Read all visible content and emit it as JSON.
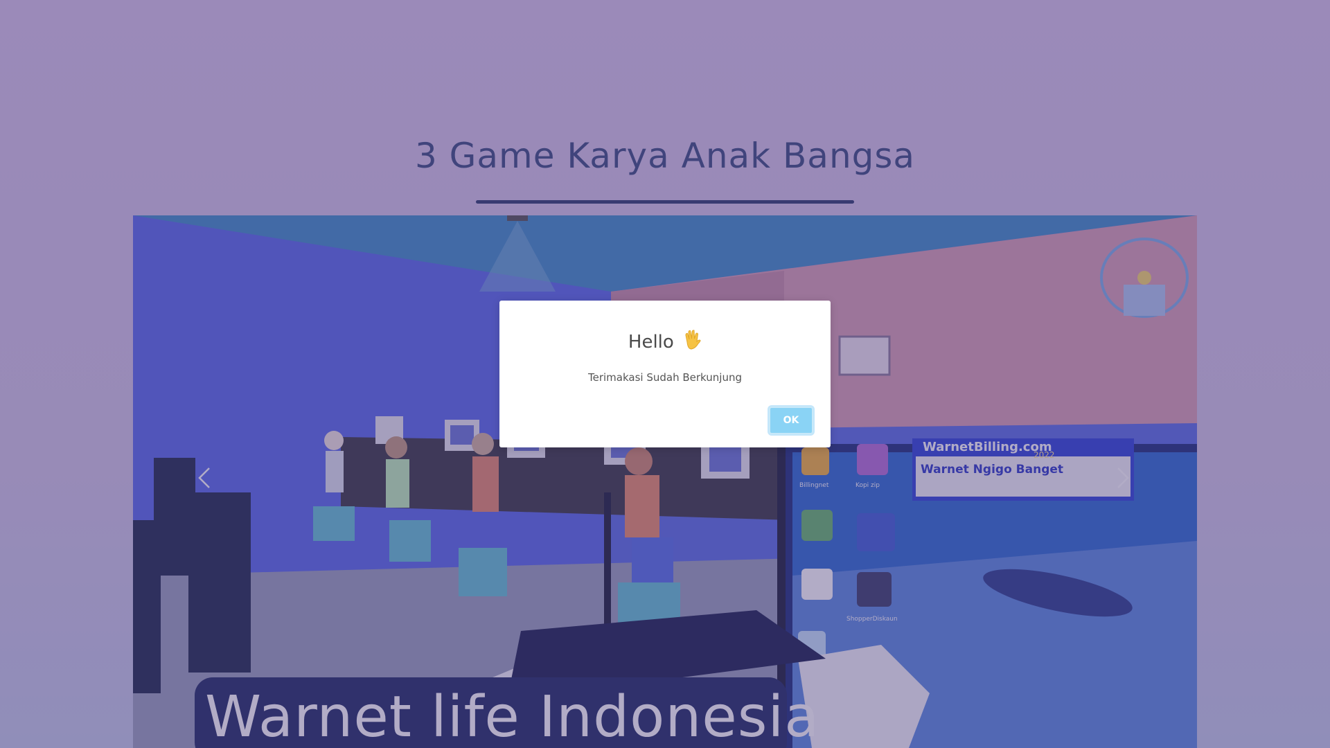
{
  "section": {
    "title": "3 Game Karya Anak Bangsa"
  },
  "carousel": {
    "caption": "Warnet life Indonesia",
    "prev_icon": "chevron-left-icon",
    "next_icon": "chevron-right-icon",
    "screen_text": {
      "banner_site": "WarnetBilling.com",
      "banner_year": "2022",
      "banner_headline": "Warnet Ngigo Banget",
      "desktop_labels": [
        "Billingnet",
        "Kopi zip",
        "ShopperDiskaun"
      ]
    }
  },
  "dialog": {
    "title": "Hello",
    "title_icon": "waving-hand-icon",
    "message": "Terimakasi Sudah Berkunjung",
    "ok_label": "OK"
  },
  "colors": {
    "title_text": "#3c4d80",
    "underline": "#2d3d6e",
    "ok_button": "#8ad3f5",
    "caption_bg": "#1f2c64"
  }
}
